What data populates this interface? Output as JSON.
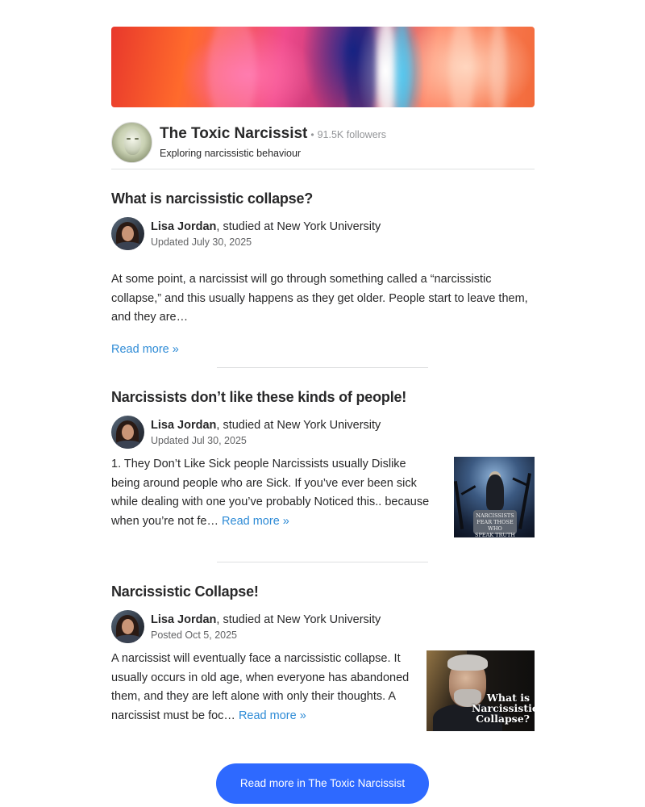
{
  "space": {
    "title": "The Toxic Narcissist",
    "separator": "•",
    "followers": "91.5K followers",
    "tagline": "Exploring narcissistic behaviour"
  },
  "posts": [
    {
      "title": "What is narcissistic collapse?",
      "author_name": "Lisa Jordan",
      "author_credential": ", studied at New York University",
      "date": "Updated July 30, 2025",
      "excerpt": "At some point, a narcissist will go through something called a “narcissistic collapse,” and this usually happens as they get older. People start to leave them, and they are…",
      "read_more": "Read more »"
    },
    {
      "title": "Narcissists don’t like these kinds of people!",
      "author_name": "Lisa Jordan",
      "author_credential": ", studied at New York University",
      "date": "Updated Jul 30, 2025",
      "excerpt": "1. They Don’t Like Sick people Narcissists usually Dislike being around people who are Sick. If you’ve ever been sick while dealing with one you’ve probably Noticed this.. because when you’re not fe… ",
      "read_more": "Read more »",
      "thumb_text": "NARCISSISTS\nFEAR THOSE WHO\nSPEAK TRUTH"
    },
    {
      "title": "Narcissistic Collapse!",
      "author_name": "Lisa Jordan",
      "author_credential": ", studied at New York University",
      "date": "Posted Oct 5, 2025",
      "excerpt": "A narcissist will eventually face a narcissistic collapse. It usually occurs in old age, when everyone has abandoned them, and they are left alone with only their thoughts. A narcissist must be foc… ",
      "read_more": "Read more »",
      "thumb_text": "What is Narcissistic Collapse?"
    }
  ],
  "cta": {
    "label": "Read more in The Toxic Narcissist"
  },
  "colors": {
    "link": "#2e8bd6",
    "cta": "#2e69ff",
    "divider": "#dee0e1"
  }
}
